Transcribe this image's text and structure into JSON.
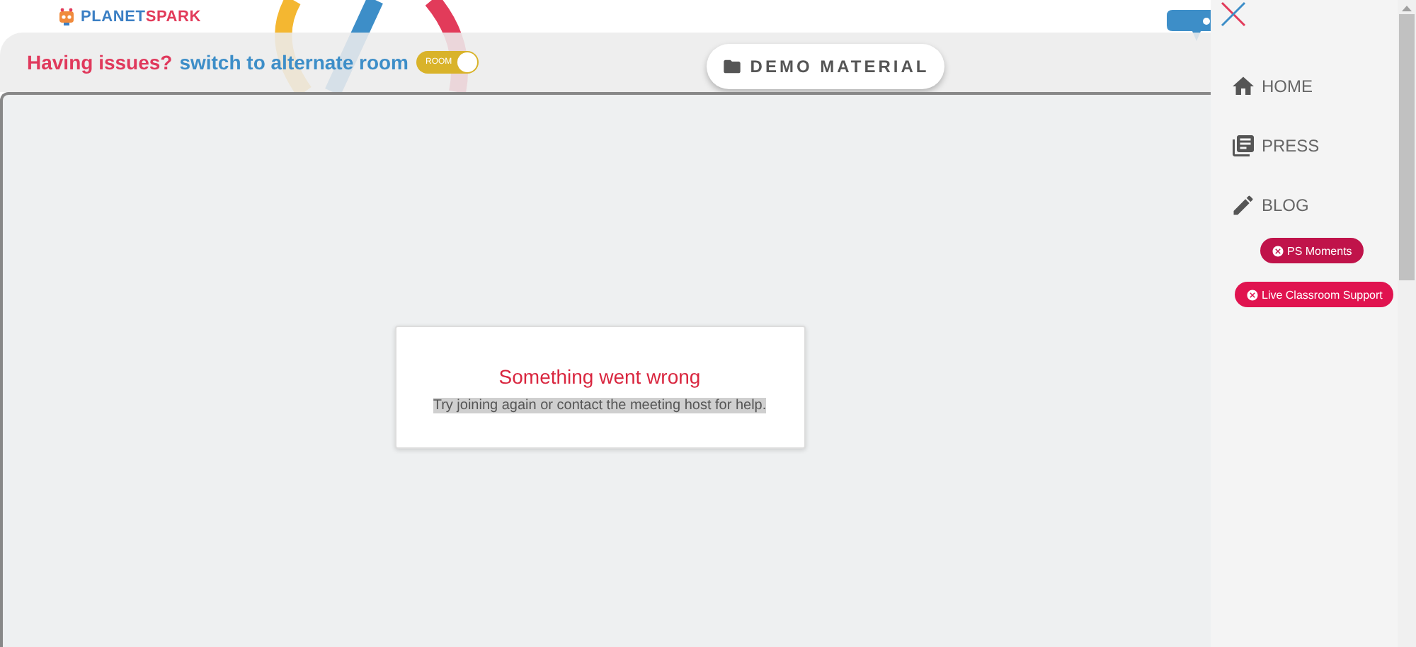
{
  "logo": {
    "parts": [
      {
        "text": "PLANET",
        "color": "#3b7fc4"
      },
      {
        "text": "SPARK",
        "color": "#e23b5a"
      }
    ]
  },
  "header": {
    "issue_text": "Having issues?",
    "switch_link": "switch to alternate room",
    "room_toggle": {
      "label": "ROOM",
      "on": true
    },
    "demo_button": "DEMO MATERIAL"
  },
  "error_card": {
    "title": "Something went wrong",
    "message": "Try joining again or contact the meeting host for help."
  },
  "sidebar": {
    "items": [
      {
        "kind": "home",
        "label": "HOME"
      },
      {
        "kind": "press",
        "label": "PRESS"
      },
      {
        "kind": "blog",
        "label": "BLOG"
      }
    ],
    "pills": [
      {
        "label": "PS Moments",
        "color": "#c0134a"
      },
      {
        "label": "Live Classroom Support",
        "color": "#e0134f"
      }
    ]
  }
}
